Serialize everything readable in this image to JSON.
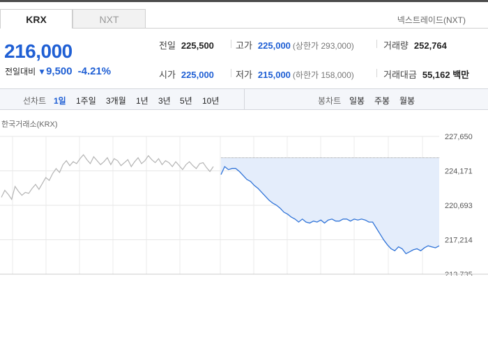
{
  "tabs": {
    "krx": "KRX",
    "nxt": "NXT"
  },
  "nxt_link": "넥스트레이드(NXT)",
  "price": {
    "current": "216,000",
    "change_label": "전일대비",
    "change_icon": "down-triangle",
    "change_glyph": "▼",
    "change_value": "9,500",
    "change_percent": "-4.21%",
    "down_color": "#1f5fd4"
  },
  "stats": {
    "prev_close": {
      "label": "전일",
      "value": "225,500"
    },
    "open": {
      "label": "시가",
      "value": "225,000"
    },
    "high": {
      "label": "고가",
      "value": "225,000",
      "limit": "(상한가 293,000)"
    },
    "low": {
      "label": "저가",
      "value": "215,000",
      "limit": "(하한가 158,000)"
    },
    "volume": {
      "label": "거래량",
      "value": "252,764"
    },
    "amount": {
      "label": "거래대금",
      "value": "55,162 백만"
    }
  },
  "chart_bar": {
    "line_chart_label": "선차트",
    "line_periods": [
      "1일",
      "1주일",
      "3개월",
      "1년",
      "3년",
      "5년",
      "10년"
    ],
    "active_period": "1일",
    "candle_label": "봉차트",
    "candle_periods": [
      "일봉",
      "주봉",
      "월봉"
    ]
  },
  "exchange_label": "한국거래소(KRX)",
  "chart_data": {
    "type": "line",
    "xlabel": "",
    "ylabel": "",
    "y_ticks": [
      "227,650",
      "224,171",
      "220,693",
      "217,214",
      "213,735"
    ],
    "ylim": [
      213735,
      227650
    ],
    "grid": true,
    "series": [
      {
        "values": [
          221500,
          222200,
          221800,
          221300,
          222600,
          222100,
          221700,
          222000,
          221900,
          222400,
          222800,
          222300,
          222900,
          223500,
          223200,
          223900,
          224400,
          224000,
          224800,
          225200,
          224700,
          225100,
          224900,
          225400,
          225800,
          225300,
          224900,
          225600,
          225200,
          224800,
          225100,
          225500,
          224800,
          225400,
          225200,
          224700,
          225000,
          225300,
          224600,
          225100,
          225500,
          224900,
          225200,
          225700,
          225300,
          225000,
          225400,
          224800,
          225200,
          225000,
          224600,
          225100,
          224700,
          224300,
          224800,
          225100,
          224700,
          224400,
          224900,
          225000,
          224500,
          224100,
          224600
        ]
      },
      {
        "values": [
          223800,
          224600,
          224300,
          224400,
          224400,
          224100,
          223700,
          223300,
          223100,
          222700,
          222400,
          222000,
          221600,
          221200,
          220900,
          220700,
          220400,
          220000,
          219800,
          219500,
          219300,
          219000,
          219300,
          219000,
          218900,
          219100,
          219000,
          219200,
          218900,
          219200,
          219300,
          219100,
          219100,
          219300,
          219300,
          219100,
          219300,
          219200,
          219300,
          219200,
          219000,
          219000,
          218400,
          217800,
          217200,
          216700,
          216300,
          216100,
          216500,
          216300,
          215800,
          216000,
          216200,
          216300,
          216100,
          216400,
          216600,
          216500,
          216400,
          216600
        ]
      }
    ],
    "reference_value": 225500,
    "colors": {
      "intraday": "#2f73d8",
      "previous": "#b4b4b4",
      "fill": "#e4edfb",
      "reference": "#999999"
    }
  }
}
